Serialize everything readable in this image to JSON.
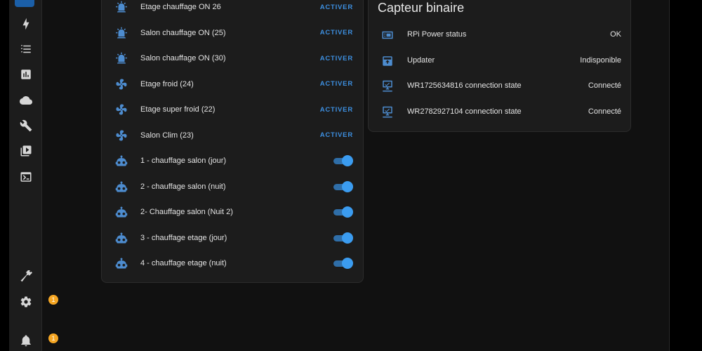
{
  "left_card": {
    "rows": [
      {
        "label": "Etage chauffage ON 26",
        "action": "ACTIVER",
        "icon": "alarm-light-icon"
      },
      {
        "label": "Salon chauffage ON (25)",
        "action": "ACTIVER",
        "icon": "alarm-light-icon"
      },
      {
        "label": "Salon chauffage ON (30)",
        "action": "ACTIVER",
        "icon": "alarm-light-icon"
      },
      {
        "label": "Etage froid (24)",
        "action": "ACTIVER",
        "icon": "fan-icon"
      },
      {
        "label": "Etage super froid (22)",
        "action": "ACTIVER",
        "icon": "fan-icon"
      },
      {
        "label": "Salon Clim (23)",
        "action": "ACTIVER",
        "icon": "fan-icon"
      },
      {
        "label": "1 - chauffage salon (jour)",
        "toggle": true,
        "icon": "robot-icon"
      },
      {
        "label": "2 - chauffage salon (nuit)",
        "toggle": true,
        "icon": "robot-icon"
      },
      {
        "label": "2- Chauffage salon (Nuit 2)",
        "toggle": true,
        "icon": "robot-icon"
      },
      {
        "label": "3 - chauffage etage (jour)",
        "toggle": true,
        "icon": "robot-icon"
      },
      {
        "label": "4 - chauffage etage (nuit)",
        "toggle": true,
        "icon": "robot-icon"
      }
    ]
  },
  "right_card": {
    "title": "Capteur binaire",
    "rows": [
      {
        "label": "RPi Power status",
        "value": "OK",
        "icon": "raspberry-pi-icon"
      },
      {
        "label": "Updater",
        "value": "Indisponible",
        "icon": "package-icon"
      },
      {
        "label": "WR1725634816 connection state",
        "value": "Connecté",
        "icon": "lan-connect-icon"
      },
      {
        "label": "WR2782927104 connection state",
        "value": "Connecté",
        "icon": "lan-connect-icon"
      }
    ]
  },
  "sidebar": {
    "settings_badge": "1",
    "notifications_badge": "1"
  },
  "colors": {
    "accent": "#3d8fe0",
    "badge": "#f5a623",
    "card": "#1c1c1c",
    "background": "#111111"
  }
}
